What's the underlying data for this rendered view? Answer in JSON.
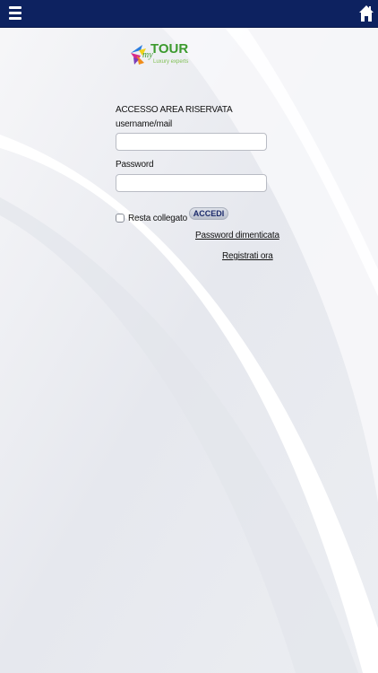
{
  "topbar": {
    "menu_icon": "hamburger-menu-icon",
    "home_icon": "home-icon"
  },
  "logo": {
    "brand_prefix": "my",
    "brand_name": "TOUR",
    "tagline": "Luxury experts"
  },
  "login": {
    "title": "ACCESSO AREA RISERVATA",
    "username_label": "username/mail",
    "username_value": "",
    "password_label": "Password",
    "password_value": "",
    "remember_label": "Resta collegato",
    "remember_checked": false,
    "submit_label": "ACCEDI",
    "forgot_link": "Password dimenticata",
    "register_link": "Registrati ora"
  },
  "colors": {
    "topbar": "#0d2260",
    "logo_green": "#3c9a2e",
    "accent": "#1b2a6b"
  }
}
